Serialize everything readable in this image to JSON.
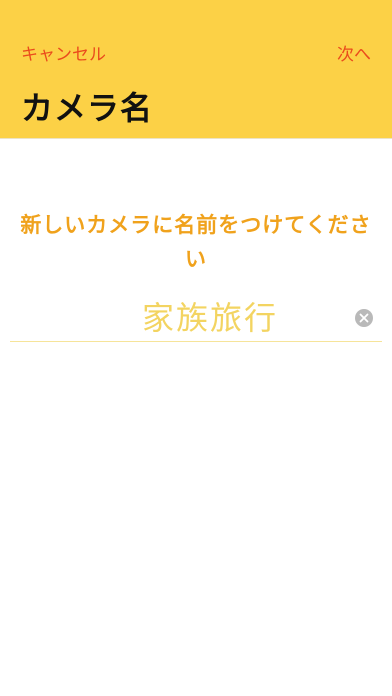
{
  "nav": {
    "cancel_label": "キャンセル",
    "next_label": "次へ",
    "title": "カメラ名"
  },
  "form": {
    "prompt": "新しいカメラに名前をつけてください",
    "name_value": "家族旅行"
  },
  "colors": {
    "header_bg": "#FCD146",
    "action_text": "#EA4B1C",
    "prompt_text": "#F0A21C",
    "input_text": "#F3D461"
  },
  "icons": {
    "clear": "clear-x-icon"
  }
}
